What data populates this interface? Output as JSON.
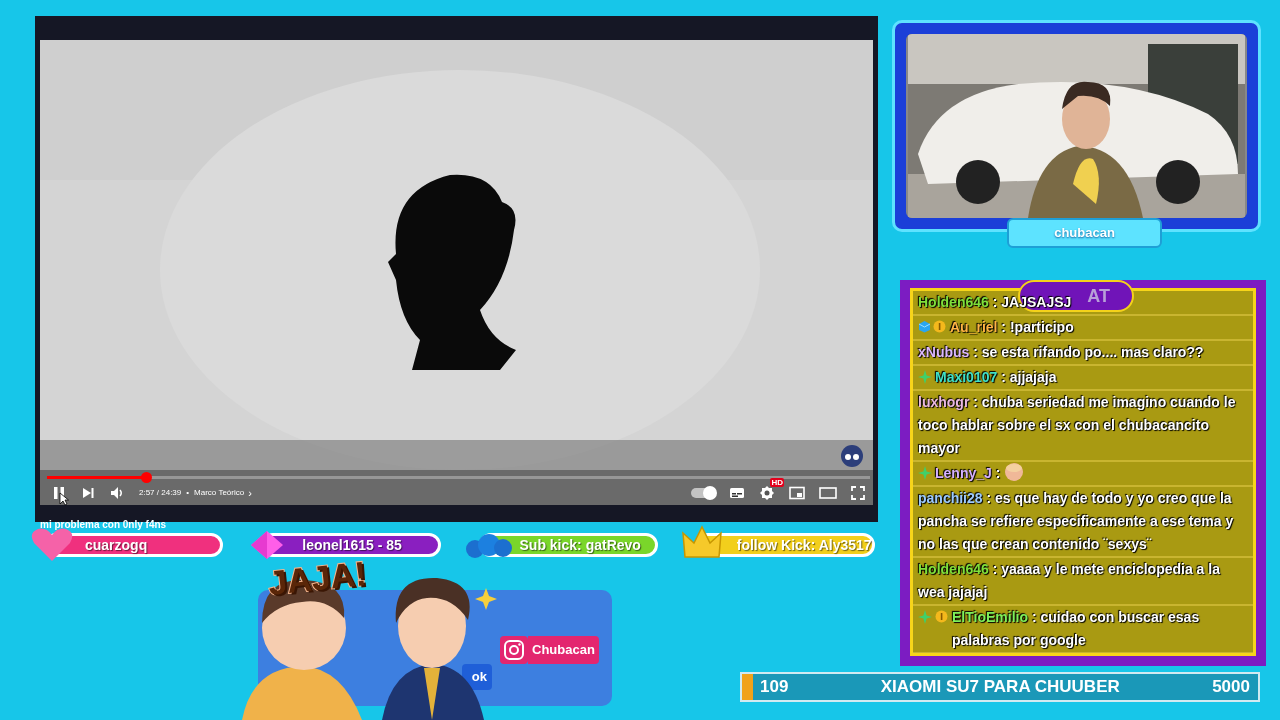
{
  "video": {
    "level": 0.12,
    "time": "2:57 / 24:39",
    "separator": "•",
    "chapter": "Marco Teórico",
    "chevron": "›",
    "autoplay": {
      "on": true
    },
    "settings_badge": "HD",
    "subtitle": "mi problema con 0nly f4ns"
  },
  "webcam": {
    "name": "chubacan"
  },
  "chat": {
    "title": "AT",
    "messages": [
      {
        "gem_badge": false,
        "sparkle_badge": false,
        "coin_badge": false,
        "user": "Holden646",
        "color": "#7fe03a",
        "separator": ":",
        "kind": "text",
        "text": "JAJSAJSJ"
      },
      {
        "gem_badge": true,
        "sparkle_badge": false,
        "coin_badge": true,
        "user": "Au_riel",
        "color": "#ffb444",
        "separator": ":",
        "kind": "text",
        "text": "!participo"
      },
      {
        "gem_badge": false,
        "sparkle_badge": false,
        "coin_badge": false,
        "user": "xNubus",
        "color": "#dcb8ff",
        "separator": ":",
        "kind": "text",
        "text": "se esta rifando po.... mas claro??"
      },
      {
        "gem_badge": false,
        "sparkle_badge": true,
        "coin_badge": false,
        "user": "Maxi0107",
        "color": "#3ee0c8",
        "separator": ":",
        "kind": "text",
        "text": "ajjajaja"
      },
      {
        "gem_badge": false,
        "sparkle_badge": false,
        "coin_badge": false,
        "user": "luxhogr",
        "color": "#eab8e0",
        "separator": ":",
        "kind": "text",
        "text": "chuba seriedad me imagino cuando le toco hablar sobre el sx con el chubacancito mayor"
      },
      {
        "gem_badge": false,
        "sparkle_badge": true,
        "coin_badge": false,
        "user": "Lenny_J",
        "color": "#d4b0ff",
        "separator": ":",
        "kind": "emote"
      },
      {
        "gem_badge": false,
        "sparkle_badge": false,
        "coin_badge": false,
        "user": "panchii28",
        "color": "#9ccaff",
        "separator": ":",
        "kind": "text",
        "text": "es que hay de todo y yo creo que la pancha se refiere especificamente a ese tema y no las que crean contenido ¨sexys¨"
      },
      {
        "gem_badge": false,
        "sparkle_badge": false,
        "coin_badge": false,
        "user": "Holden646",
        "color": "#7fe03a",
        "separator": ":",
        "kind": "text",
        "text": "yaaaa y le mete enciclopedia a la wea jajajaj"
      },
      {
        "gem_badge": false,
        "sparkle_badge": true,
        "coin_badge": true,
        "user": "ElTioEmilio",
        "color": "#7ef05a",
        "separator": ":",
        "kind": "text",
        "text": "cuidao con buscar esas palabras por google"
      }
    ]
  },
  "alerts": [
    {
      "kind": "heart",
      "text": "cuarzogq",
      "color": "#f0307e"
    },
    {
      "kind": "diamond",
      "text": "leonel1615 - 85",
      "color": "#8a1fc0"
    },
    {
      "kind": "money",
      "text": "Sub kick: gatRevo",
      "color": "#7ad62a"
    },
    {
      "kind": "crown",
      "text": "follow Kick: Aly3517",
      "color": "#f2cf1c"
    }
  ],
  "sticker": {
    "text": "JAJA!"
  },
  "socials": [
    {
      "kind": "facebook",
      "text": "ok"
    },
    {
      "kind": "instagram",
      "text": "Chubacan"
    }
  ],
  "goal": {
    "current": "109",
    "title": "XIAOMI SU7 PARA CHUUBER",
    "target": "5000",
    "level": 0.022
  }
}
